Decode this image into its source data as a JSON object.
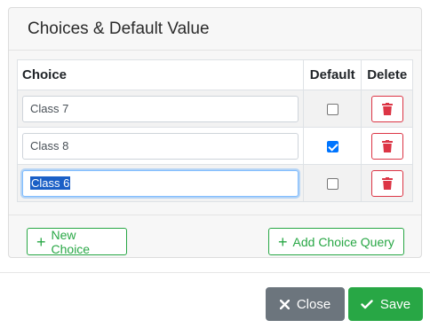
{
  "panel": {
    "title": "Choices & Default Value"
  },
  "table": {
    "headers": {
      "choice": "Choice",
      "default": "Default",
      "delete": "Delete"
    },
    "rows": [
      {
        "choice": "Class 7",
        "default": false
      },
      {
        "choice": "Class 8",
        "default": true
      },
      {
        "choice": "Class 6",
        "default": false,
        "focused": true,
        "selected_text": true
      }
    ]
  },
  "footer": {
    "new_choice_label": "New Choice",
    "add_query_label": "Add Choice Query"
  },
  "dialog": {
    "close_label": "Close",
    "save_label": "Save"
  },
  "colors": {
    "danger": "#dc3545",
    "success": "#28a745",
    "secondary": "#6c757d",
    "checkbox": "#0075ff"
  },
  "icons": {
    "delete": "trash-icon",
    "add": "plus-icon",
    "close": "x-icon",
    "save": "check-icon"
  }
}
